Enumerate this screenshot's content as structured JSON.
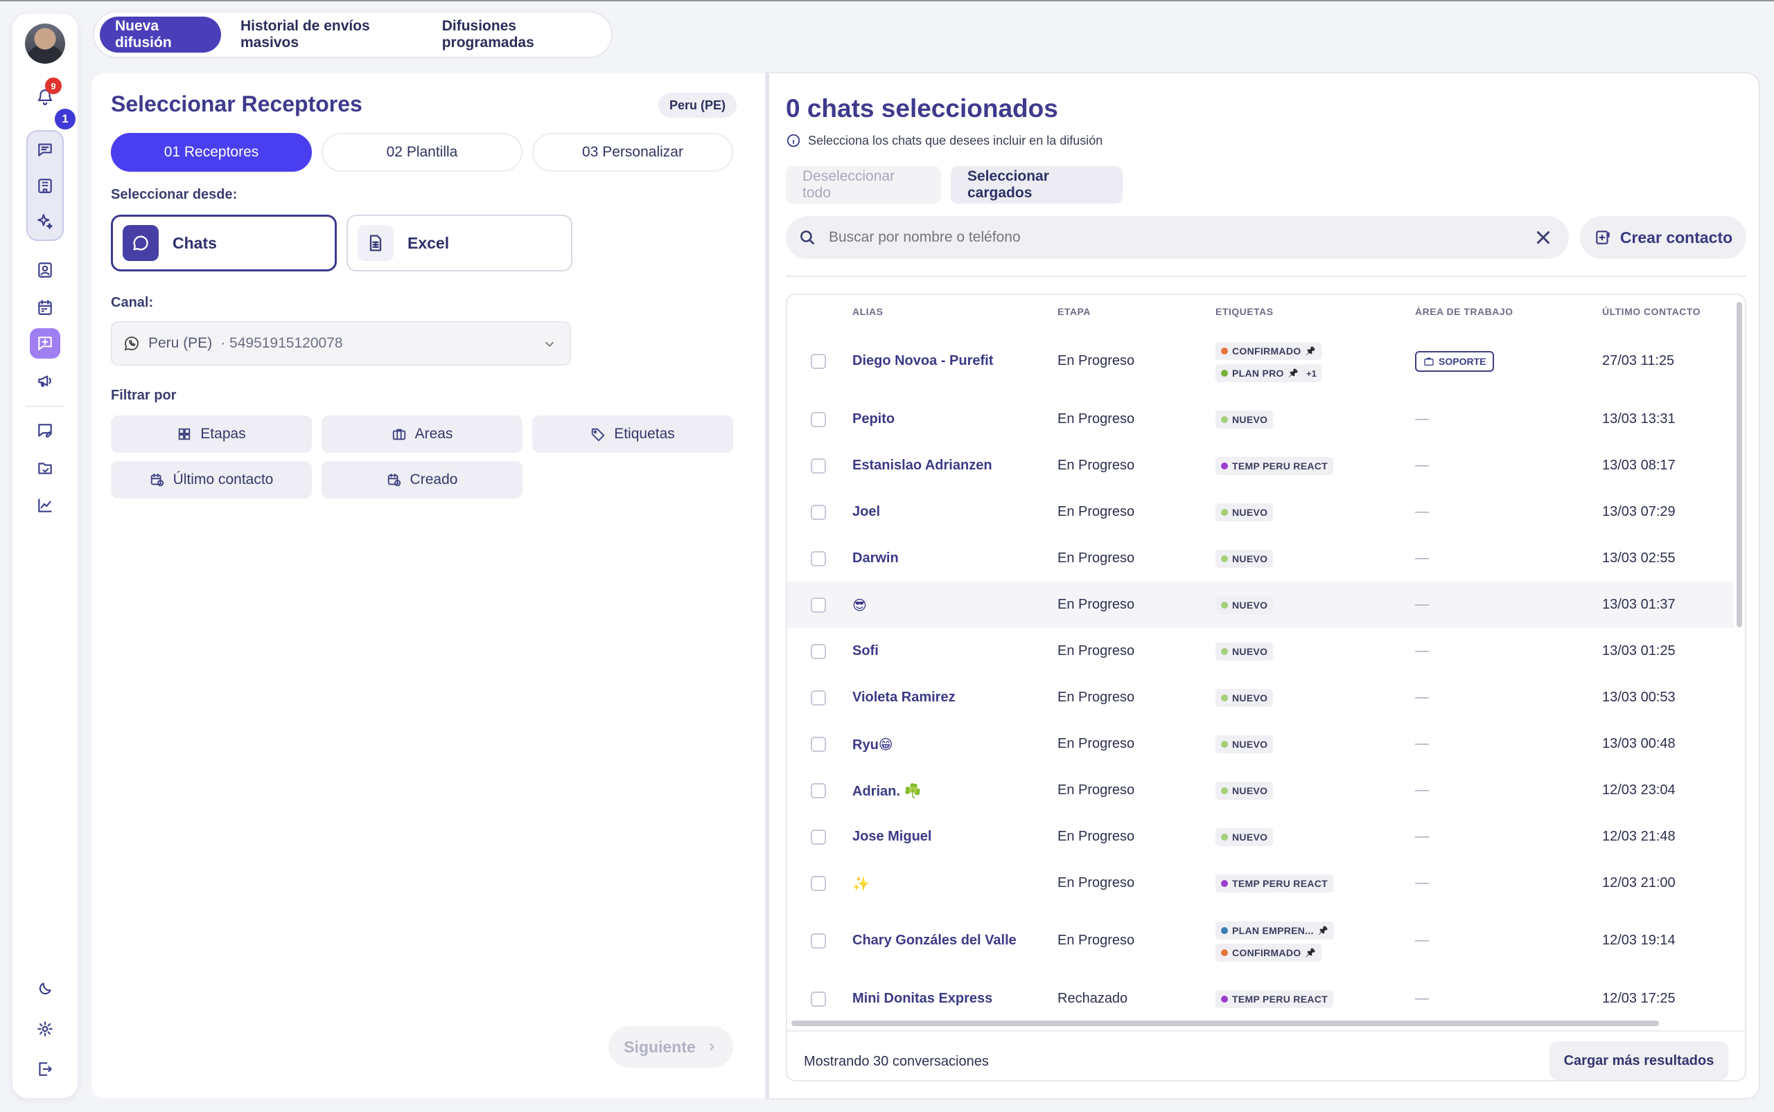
{
  "colors": {
    "accent": "#4a3ff0",
    "accent_dark": "#4a3fb8",
    "title": "#3e3a8c"
  },
  "rail": {
    "notifications_badge": "9",
    "chats_badge": "1",
    "icons": [
      "bell-icon",
      "chat-icon",
      "building-icon",
      "sparkles-icon",
      "contact-icon",
      "calendar-icon",
      "broadcast-icon",
      "megaphone-icon",
      "message-edit-icon",
      "folder-chat-icon",
      "chart-icon",
      "moon-icon",
      "gear-icon",
      "logout-icon"
    ]
  },
  "top_tabs": [
    {
      "label": "Nueva difusión",
      "active": true
    },
    {
      "label": "Historial de envíos masivos",
      "active": false
    },
    {
      "label": "Difusiones programadas",
      "active": false
    }
  ],
  "left": {
    "title": "Seleccionar Receptores",
    "country_pill": "Peru (PE)",
    "steps": [
      "01 Receptores",
      "02 Plantilla",
      "03 Personalizar"
    ],
    "select_from_label": "Seleccionar desde:",
    "sources": [
      "Chats",
      "Excel"
    ],
    "channel_label": "Canal:",
    "channel_name": "Peru (PE)",
    "channel_number": "· 54951915120078",
    "filter_label": "Filtrar por",
    "filters": [
      "Etapas",
      "Areas",
      "Etiquetas",
      "Último contacto",
      "Creado"
    ],
    "next_label": "Siguiente"
  },
  "right": {
    "title": "0 chats seleccionados",
    "info": "Selecciona los chats que desees incluir en la difusión",
    "deselect_label": "Deseleccionar todo",
    "select_loaded_label": "Seleccionar cargados",
    "search_placeholder": "Buscar por nombre o teléfono",
    "create_contact_label": "Crear contacto",
    "columns": [
      "ALIAS",
      "ETAPA",
      "ETIQUETAS",
      "ÁREA DE TRABAJO",
      "ÚLTIMO CONTACTO"
    ],
    "rows": [
      {
        "alias": "Diego Novoa - Purefit",
        "etapa": "En Progreso",
        "fecha": "27/03 11:25",
        "area": "SOPORTE",
        "tags": [
          {
            "label": "CONFIRMADO",
            "color": "#e8743b",
            "pin": true
          },
          {
            "label": "PLAN PRO",
            "color": "#7ab03a",
            "pin": true
          }
        ],
        "more": "+1"
      },
      {
        "alias": "Pepito",
        "etapa": "En Progreso",
        "fecha": "13/03 13:31",
        "area": "—",
        "tags": [
          {
            "label": "NUEVO",
            "color": "#a6cf7a",
            "pin": false
          }
        ]
      },
      {
        "alias": "Estanislao Adrianzen",
        "etapa": "En Progreso",
        "fecha": "13/03 08:17",
        "area": "—",
        "tags": [
          {
            "label": "TEMP PERU REACT",
            "color": "#9b3fcf",
            "pin": false
          }
        ]
      },
      {
        "alias": "Joel",
        "etapa": "En Progreso",
        "fecha": "13/03 07:29",
        "area": "—",
        "tags": [
          {
            "label": "NUEVO",
            "color": "#a6cf7a",
            "pin": false
          }
        ]
      },
      {
        "alias": "Darwin",
        "etapa": "En Progreso",
        "fecha": "13/03 02:55",
        "area": "—",
        "tags": [
          {
            "label": "NUEVO",
            "color": "#a6cf7a",
            "pin": false
          }
        ]
      },
      {
        "alias": "😎",
        "etapa": "En Progreso",
        "fecha": "13/03 01:37",
        "area": "—",
        "tags": [
          {
            "label": "NUEVO",
            "color": "#a6cf7a",
            "pin": false
          }
        ]
      },
      {
        "alias": "Sofi",
        "etapa": "En Progreso",
        "fecha": "13/03 01:25",
        "area": "—",
        "tags": [
          {
            "label": "NUEVO",
            "color": "#a6cf7a",
            "pin": false
          }
        ]
      },
      {
        "alias": "Violeta Ramirez",
        "etapa": "En Progreso",
        "fecha": "13/03 00:53",
        "area": "—",
        "tags": [
          {
            "label": "NUEVO",
            "color": "#a6cf7a",
            "pin": false
          }
        ]
      },
      {
        "alias": "Ryu😁",
        "etapa": "En Progreso",
        "fecha": "13/03 00:48",
        "area": "—",
        "tags": [
          {
            "label": "NUEVO",
            "color": "#a6cf7a",
            "pin": false
          }
        ]
      },
      {
        "alias": "Adrian. ☘️",
        "etapa": "En Progreso",
        "fecha": "12/03 23:04",
        "area": "—",
        "tags": [
          {
            "label": "NUEVO",
            "color": "#a6cf7a",
            "pin": false
          }
        ]
      },
      {
        "alias": "Jose Miguel",
        "etapa": "En Progreso",
        "fecha": "12/03 21:48",
        "area": "—",
        "tags": [
          {
            "label": "NUEVO",
            "color": "#a6cf7a",
            "pin": false
          }
        ]
      },
      {
        "alias": "✨",
        "etapa": "En Progreso",
        "fecha": "12/03 21:00",
        "area": "—",
        "tags": [
          {
            "label": "TEMP PERU REACT",
            "color": "#9b3fcf",
            "pin": false
          }
        ]
      },
      {
        "alias": "Chary Gonzáles del Valle",
        "etapa": "En Progreso",
        "fecha": "12/03 19:14",
        "area": "—",
        "tags": [
          {
            "label": "PLAN EMPREN...",
            "color": "#3a7fb0",
            "pin": true
          },
          {
            "label": "CONFIRMADO",
            "color": "#e8743b",
            "pin": true
          }
        ]
      },
      {
        "alias": "Mini Donitas Express",
        "etapa": "Rechazado",
        "fecha": "12/03 17:25",
        "area": "—",
        "tags": [
          {
            "label": "TEMP PERU REACT",
            "color": "#9b3fcf",
            "pin": false
          }
        ]
      }
    ],
    "footer_text": "Mostrando 30 conversaciones",
    "load_more_label": "Cargar más resultados"
  }
}
